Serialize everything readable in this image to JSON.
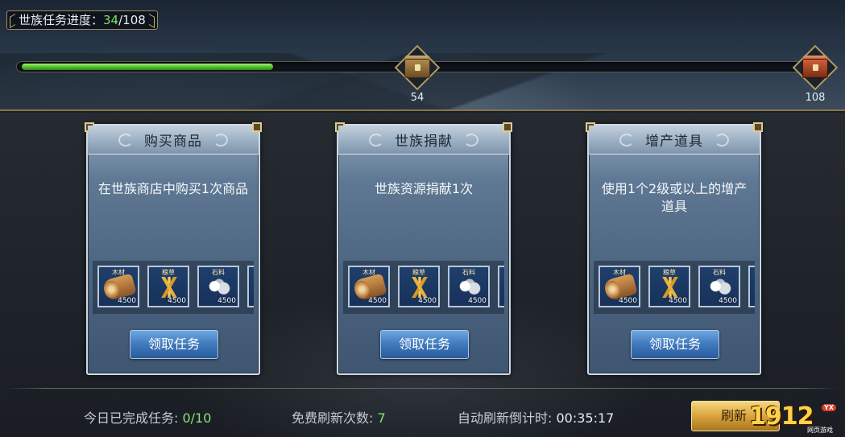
{
  "progress": {
    "label": "世族任务进度：",
    "current": "34",
    "separator": "/",
    "total": "108",
    "fraction": 0.3148,
    "milestones": [
      {
        "value": "54",
        "chest": "treasure-chest-gold-icon"
      },
      {
        "value": "108",
        "chest": "treasure-chest-red-icon"
      }
    ]
  },
  "tasks": [
    {
      "title": "购买商品",
      "description": "在世族商店中购买1次商品",
      "rewards": [
        {
          "name": "木材",
          "amount": "4500",
          "icon": "wood-log-icon"
        },
        {
          "name": "粮草",
          "amount": "4500",
          "icon": "grain-icon"
        },
        {
          "name": "石料",
          "amount": "4500",
          "icon": "stone-icon"
        }
      ],
      "button": "领取任务"
    },
    {
      "title": "世族捐献",
      "description": "世族资源捐献1次",
      "rewards": [
        {
          "name": "木材",
          "amount": "4500",
          "icon": "wood-log-icon"
        },
        {
          "name": "粮草",
          "amount": "4500",
          "icon": "grain-icon"
        },
        {
          "name": "石料",
          "amount": "4500",
          "icon": "stone-icon"
        }
      ],
      "button": "领取任务"
    },
    {
      "title": "增产道具",
      "description": "使用1个2级或以上的增产道具",
      "rewards": [
        {
          "name": "木材",
          "amount": "4500",
          "icon": "wood-log-icon"
        },
        {
          "name": "粮草",
          "amount": "4500",
          "icon": "grain-icon"
        },
        {
          "name": "石料",
          "amount": "4500",
          "icon": "stone-icon"
        }
      ],
      "button": "领取任务"
    }
  ],
  "footer": {
    "completed_label": "今日已完成任务: ",
    "completed_value": "0/10",
    "free_refresh_label": "免费刷新次数: ",
    "free_refresh_value": "7",
    "auto_refresh_label": "自动刷新倒计时: ",
    "auto_refresh_value": "00:35:17",
    "refresh_button": "刷新"
  },
  "watermark": {
    "text": "1912",
    "badge": "YX",
    "sub": "网页游戏"
  },
  "colors": {
    "progress_fill": "#52c22e",
    "highlight_value": "#8be27a",
    "card_blue": "#5f7893",
    "claim_button": "#3f79bd",
    "refresh_button": "#d9a43e"
  }
}
